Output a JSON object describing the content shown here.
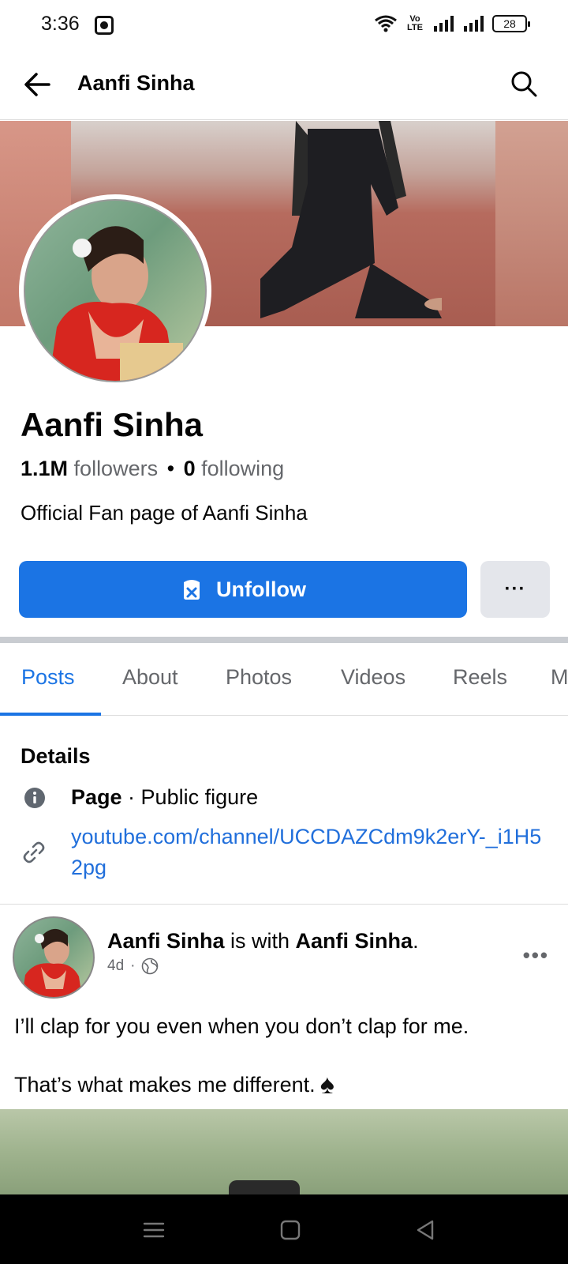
{
  "status_bar": {
    "time": "3:36",
    "network_label": "Vo LTE",
    "battery": "28"
  },
  "header": {
    "title": "Aanfi Sinha",
    "back_icon": "arrow-left-icon",
    "search_icon": "search-icon"
  },
  "profile": {
    "name": "Aanfi Sinha",
    "followers_count": "1.1M",
    "followers_label": "followers",
    "separator": "•",
    "following_count": "0",
    "following_label": "following",
    "bio": "Official Fan page of Aanfi Sinha",
    "unfollow_label": "Unfollow",
    "more_label": "···"
  },
  "tabs": [
    {
      "label": "Posts",
      "active": true
    },
    {
      "label": "About",
      "active": false
    },
    {
      "label": "Photos",
      "active": false
    },
    {
      "label": "Videos",
      "active": false
    },
    {
      "label": "Reels",
      "active": false
    },
    {
      "label": "M",
      "active": false
    }
  ],
  "details": {
    "title": "Details",
    "page_label": "Page",
    "page_category": " · Public figure",
    "link": "youtube.com/channel/UCCDAZCdm9k2erY-_i1H52pg"
  },
  "post": {
    "author": "Aanfi Sinha",
    "with_text": " is with ",
    "tagged": "Aanfi Sinha",
    "period": ".",
    "time": "4d",
    "dot": "·",
    "privacy_icon": "globe-icon",
    "more_label": "•••",
    "line1": "I’ll clap for you even when you don’t clap for me.",
    "line2": "That’s what makes me different.",
    "emoji": "♠"
  },
  "colors": {
    "accent": "#1b74e4",
    "link": "#216fdb",
    "secondary_text": "#65676b",
    "button_gray": "#e4e6eb"
  }
}
